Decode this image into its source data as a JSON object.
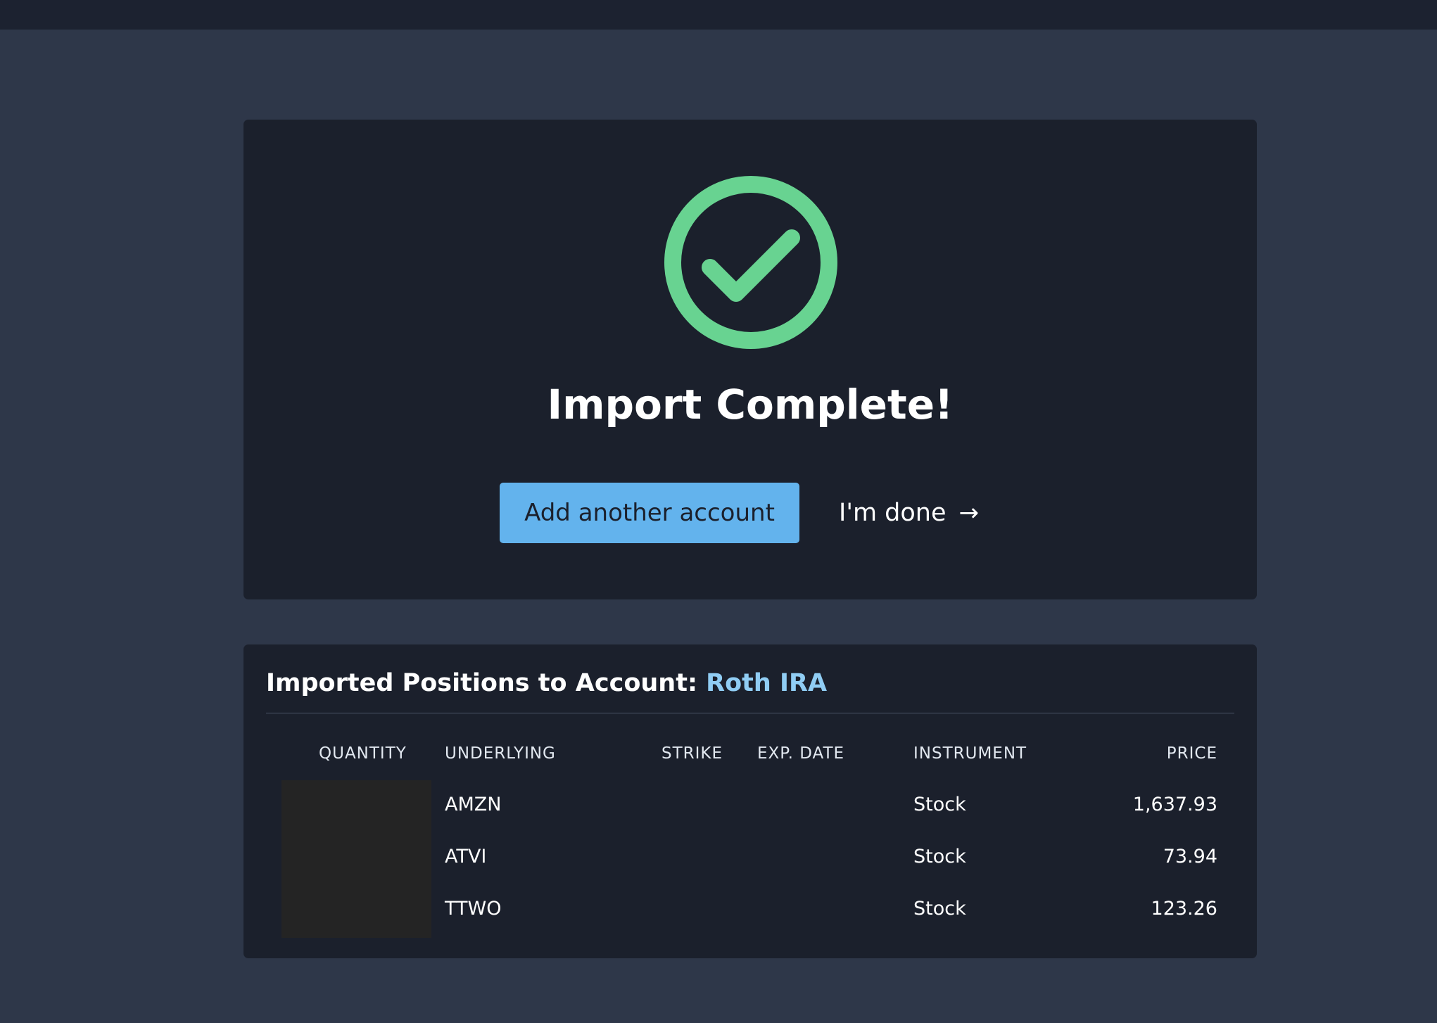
{
  "success": {
    "title": "Import Complete!",
    "add_account_label": "Add another account",
    "done_label": "I'm done",
    "done_arrow": "→",
    "icon": "check-circle-icon"
  },
  "positions": {
    "heading_prefix": "Imported Positions to Account:",
    "account_name": "Roth IRA",
    "columns": {
      "quantity": "QUANTITY",
      "underlying": "UNDERLYING",
      "strike": "STRIKE",
      "exp_date": "EXP. DATE",
      "instrument": "INSTRUMENT",
      "price": "PRICE"
    },
    "rows": [
      {
        "underlying": "AMZN",
        "instrument": "Stock",
        "price": "1,637.93"
      },
      {
        "underlying": "ATVI",
        "instrument": "Stock",
        "price": "73.94"
      },
      {
        "underlying": "TTWO",
        "instrument": "Stock",
        "price": "123.26"
      }
    ]
  },
  "colors": {
    "background": "#2e3749",
    "card": "#1b202c",
    "accent": "#63b3ed",
    "success": "#68d391",
    "account_link": "#90cdf4"
  }
}
